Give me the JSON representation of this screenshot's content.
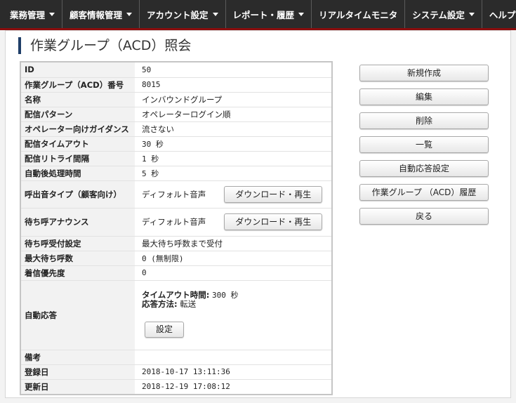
{
  "nav": {
    "items": [
      {
        "label": "業務管理",
        "dropdown": true
      },
      {
        "label": "顧客情報管理",
        "dropdown": true
      },
      {
        "label": "アカウント設定",
        "dropdown": true
      },
      {
        "label": "レポート・履歴",
        "dropdown": true
      },
      {
        "label": "リアルタイムモニタ",
        "dropdown": false
      },
      {
        "label": "システム設定",
        "dropdown": true
      },
      {
        "label": "ヘルプ",
        "dropdown": true
      }
    ]
  },
  "page": {
    "title": "作業グループ（ACD）照会"
  },
  "info": {
    "id": {
      "label": "ID",
      "value": "50"
    },
    "number": {
      "label": "作業グループ（ACD）番号",
      "value": "8015"
    },
    "name": {
      "label": "名称",
      "value": "インバウンドグループ"
    },
    "pattern": {
      "label": "配信パターン",
      "value": "オペレーターログイン順"
    },
    "guidance": {
      "label": "オペレーター向けガイダンス",
      "value": "流さない"
    },
    "timeout": {
      "label": "配信タイムアウト",
      "value": "30 秒"
    },
    "retry": {
      "label": "配信リトライ間隔",
      "value": "1 秒"
    },
    "after": {
      "label": "自動後処理時間",
      "value": "5 秒"
    },
    "ring": {
      "label": "呼出音タイプ（顧客向け）",
      "value": "ディフォルト音声",
      "button": "ダウンロード・再生"
    },
    "announce": {
      "label": "待ち呼アナウンス",
      "value": "ディフォルト音声",
      "button": "ダウンロード・再生"
    },
    "accept": {
      "label": "待ち呼受付設定",
      "value": "最大待ち呼数まで受付"
    },
    "maxwait": {
      "label": "最大待ち呼数",
      "value": "0 (無制限)"
    },
    "priority": {
      "label": "着信優先度",
      "value": "0"
    },
    "auto": {
      "label": "自動応答",
      "timeout_label": "タイムアウト時間:",
      "timeout_value": "300 秒",
      "method_label": "応答方法:",
      "method_value": "転送",
      "button": "設定"
    },
    "remarks": {
      "label": "備考",
      "value": ""
    },
    "created": {
      "label": "登録日",
      "value": "2018-10-17 13:11:36"
    },
    "updated": {
      "label": "更新日",
      "value": "2018-12-19 17:08:12"
    }
  },
  "actions": [
    "新規作成",
    "編集",
    "削除",
    "一覧",
    "自動応答設定",
    "作業グループ （ACD）履歴",
    "戻る"
  ],
  "colors": {
    "nav_bg": "#2b2b2b",
    "nav_accent": "#8a0d0d",
    "title_bar": "#1f3e68"
  }
}
